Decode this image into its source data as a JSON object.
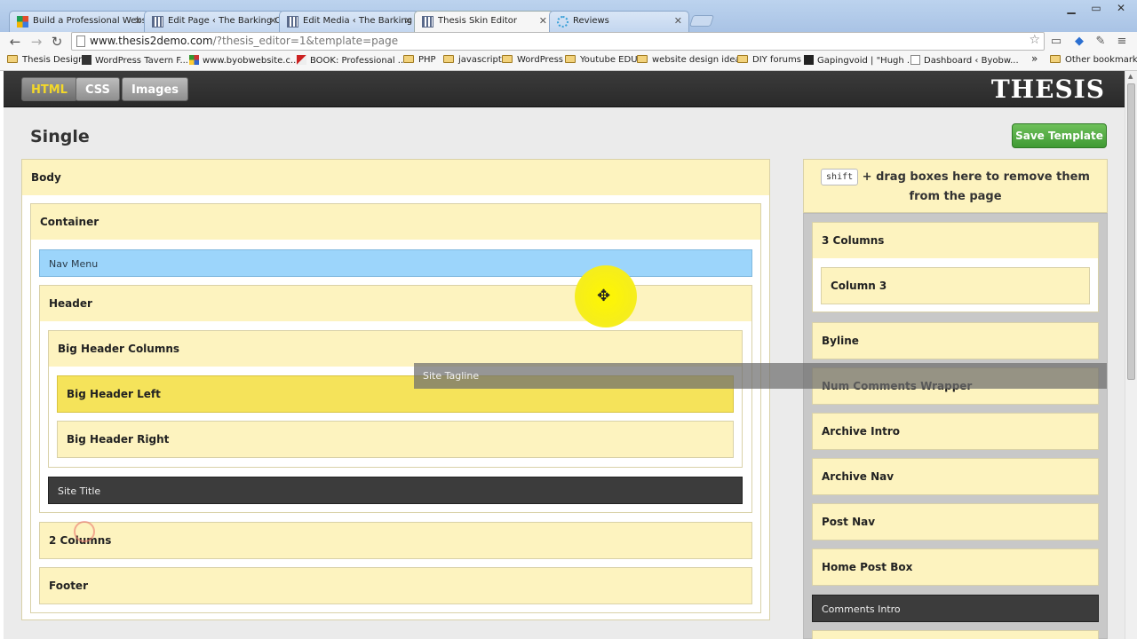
{
  "browser": {
    "tabs": [
      {
        "title": "Build a Professional Websit",
        "fav_color": "#e34b2b"
      },
      {
        "title": "Edit Page ‹ The Barking Ch",
        "fav_color": "#5a6a8a"
      },
      {
        "title": "Edit Media ‹ The Barking C",
        "fav_color": "#5a6a8a"
      },
      {
        "title": "Thesis Skin Editor",
        "fav_color": "#5a6a8a"
      },
      {
        "title": "Reviews",
        "fav_color": "#3aa0d8"
      }
    ],
    "active_tab": 3,
    "url_host": "www.thesis2demo.com",
    "url_rest": "/?thesis_editor=1&template=page",
    "bookmarks": [
      {
        "label": "Thesis Design",
        "type": "folder"
      },
      {
        "label": "WordPress Tavern F...",
        "type": "site"
      },
      {
        "label": "www.byobwebsite.c...",
        "type": "site"
      },
      {
        "label": "BOOK: Professional ...",
        "type": "site"
      },
      {
        "label": "PHP",
        "type": "folder"
      },
      {
        "label": "javascript",
        "type": "folder"
      },
      {
        "label": "WordPress",
        "type": "folder"
      },
      {
        "label": "Youtube EDU",
        "type": "folder"
      },
      {
        "label": "website design ideas",
        "type": "folder"
      },
      {
        "label": "DIY forums",
        "type": "folder"
      },
      {
        "label": "Gapingvoid | \"Hugh ...",
        "type": "site"
      },
      {
        "label": "Dashboard ‹ Byobw...",
        "type": "site"
      }
    ],
    "bookmarks_overflow": "»",
    "other_bookmarks": "Other bookmarks"
  },
  "thesis": {
    "modes": [
      "HTML",
      "CSS",
      "Images"
    ],
    "active_mode": "HTML",
    "logo": "THESIS",
    "page_title": "Single",
    "save_label": "Save Template"
  },
  "template": {
    "body": "Body",
    "container": "Container",
    "nav_menu": "Nav Menu",
    "header": "Header",
    "big_header_columns": "Big Header Columns",
    "big_header_left": "Big Header Left",
    "big_header_right": "Big Header Right",
    "site_title": "Site Title",
    "two_columns": "2 Columns",
    "footer": "Footer"
  },
  "dragging": "Site Tagline",
  "tray": {
    "hint_key": "shift",
    "hint_text": "+ drag boxes here to remove them from the page",
    "three_columns": "3 Columns",
    "column3": "Column 3",
    "items": [
      "Byline",
      "Num Comments Wrapper",
      "Archive Intro",
      "Archive Nav",
      "Post Nav",
      "Home Post Box"
    ],
    "comments_intro": "Comments Intro"
  },
  "colors": {
    "box_head": "#fdf3bf",
    "nav_menu": "#9cd5fb",
    "highlight": "#f5e35a",
    "dark_element": "#3c3c3c",
    "save_green": "#4caa3d"
  }
}
